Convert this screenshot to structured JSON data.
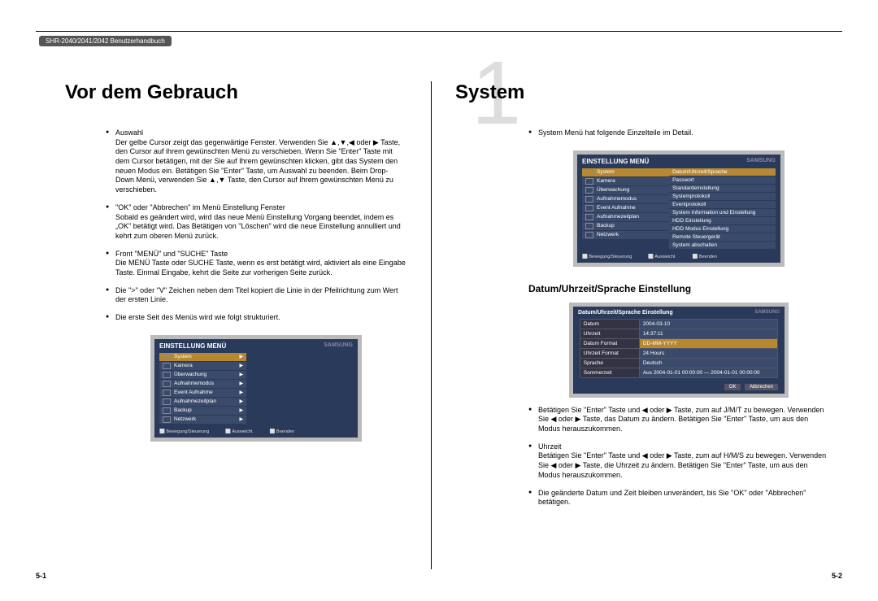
{
  "header_label": "SHR-2040/2041/2042 Benutzerhandbuch",
  "big_chapter": "1",
  "left": {
    "title": "Vor dem Gebrauch",
    "bullets": [
      {
        "head": "Auswahl",
        "body": "Der gelbe Cursor zeigt das gegenwärtige Fenster. Verwenden Sie ▲,▼,◀ oder ▶ Taste, den Cursor auf ihrem gewünschten Menü zu verschieben. Wenn Sie \"Enter\" Taste mit dem Cursor betätigen, mit der Sie auf Ihrem gewünschten klicken, gibt das System den neuen Modus ein. Betätigen Sie \"Enter\" Taste, um Auswahl zu beenden. Beim Drop-Down Menü, verwenden Sie ▲,▼ Taste, den Cursor auf Ihrem gewünschten Menü zu verschieben."
      },
      {
        "head": "\"OK\" oder \"Abbrechen\" im Menü Einstellung Fenster",
        "body": "Sobald es geändert wird, wird das neue Menü Einstellung Vorgang beendet, indem es „OK\" betätigt wird. Das Betätigen von \"Löschen\" wird die neue Einstellung annulliert und kehrt zum oberen Menü zurück."
      },
      {
        "head": "Front \"MENÜ\" und \"SUCHE\" Taste",
        "body": "Die MENÜ Taste oder SUCHE Taste, wenn es erst betätigt wird, aktiviert als eine Eingabe Taste. Einmal Eingabe, kehrt die Seite zur vorherigen Seite zurück."
      },
      {
        "head": "",
        "body": "Die \">\" oder \"V\" Zeichen neben dem Titel kopiert die Linie in der Pfeilrichtung zum Wert der ersten Linie."
      },
      {
        "head": "",
        "body": "Die erste Seit des Menüs wird wie folgt strukturiert."
      }
    ],
    "menu": {
      "title": "EINSTELLUNG MENÜ",
      "logo": "SAMSUNG",
      "items": [
        "System",
        "Kamera",
        "Überwachung",
        "Aufnahmemodus",
        "Event Aufnahme",
        "Aufnahmezeitplan",
        "Backup",
        "Netzwerk"
      ],
      "footer": [
        "Bewegung/Steuerung",
        "Ausweichl.",
        "Beenden"
      ]
    }
  },
  "right": {
    "title": "System",
    "intro": "System Menü hat folgende Einzelteile im Detail.",
    "menu": {
      "title": "EINSTELLUNG MENÜ",
      "logo": "SAMSUNG",
      "items_left": [
        "System",
        "Kamera",
        "Überwachung",
        "Aufnahmemodus",
        "Event Aufnahme",
        "Aufnahmezeitplan",
        "Backup",
        "Netzwerk"
      ],
      "items_right": [
        "Datum/Uhrzeit/Sprache",
        "Passwort",
        "Standardeinstellung",
        "Systemprotokoll",
        "Eventprotokoll",
        "System Information und Einstellung",
        "HDD Einstellung",
        "HDD Modus Einstellung",
        "Remote Steuergerät",
        "System abschalten"
      ],
      "footer": [
        "Bewegung/Steuerung",
        "Ausweichl.",
        "Beenden"
      ]
    },
    "subheading": "Datum/Uhrzeit/Sprache Einstellung",
    "settings": {
      "title": "Datum/Uhrzeit/Sprache Einstellung",
      "logo": "SAMSUNG",
      "rows": [
        {
          "label": "Datum",
          "value": "2004-03-10"
        },
        {
          "label": "Uhrzeit",
          "value": "14:37:11"
        },
        {
          "label": "Datum Format",
          "value": "DD-MM-YYYY",
          "highlight": true
        },
        {
          "label": "Uhrzeit Format",
          "value": "24 Hours"
        },
        {
          "label": "Sprache",
          "value": "Deutsch"
        },
        {
          "label": "Sommerzeit",
          "value": "Aus    2004-01-01 00:00:00  —  2004-01-01 00:00:00"
        }
      ],
      "ok": "OK",
      "cancel": "Abbrechen"
    },
    "lower_bullets": [
      "Betätigen Sie \"Enter\" Taste und ◀ oder ▶ Taste, zum auf J/M/T zu bewegen. Verwenden Sie ◀ oder ▶ Taste, das Datum zu ändern. Betätigen Sie \"Enter\" Taste, um aus den Modus herauszukommen.",
      "Uhrzeit\nBetätigen Sie \"Enter\" Taste und ◀ oder ▶ Taste, zum auf H/M/S zu bewegen. Verwenden Sie ◀ oder ▶ Taste, die Uhrzeit zu ändern. Betätigen Sie \"Enter\" Taste, um aus den Modus herauszukommen.",
      "Die geänderte Datum und Zeit bleiben unverändert, bis Sie \"OK\" oder \"Abbrechen\" betätigen."
    ]
  },
  "page_left": "5-1",
  "page_right": "5-2"
}
